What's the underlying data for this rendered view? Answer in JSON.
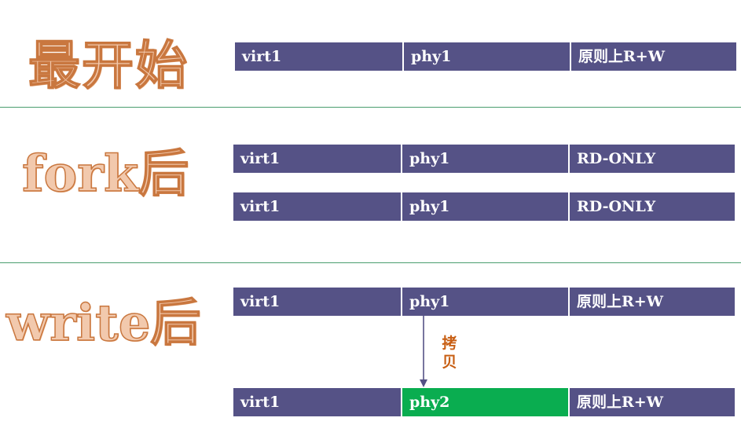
{
  "sections": {
    "start": {
      "title": "最开始"
    },
    "fork": {
      "title": "fork后"
    },
    "write": {
      "title": "write后"
    }
  },
  "rows": {
    "start": {
      "virt": "virt1",
      "phys": "phy1",
      "perm": "原则上R+W"
    },
    "fork_1": {
      "virt": "virt1",
      "phys": "phy1",
      "perm": "RD-ONLY"
    },
    "fork_2": {
      "virt": "virt1",
      "phys": "phy1",
      "perm": "RD-ONLY"
    },
    "write_1": {
      "virt": "virt1",
      "phys": "phy1",
      "perm": "原则上R+W"
    },
    "write_2": {
      "virt": "virt1",
      "phys": "phy2",
      "perm": "原则上R+W"
    }
  },
  "copy_label": "拷贝",
  "colors": {
    "cell": "#555286",
    "new_page": "#0aad50",
    "title_fill": "#f2c9ad",
    "title_stroke": "#c9773f",
    "copy_label": "#c85f14",
    "divider": "#4a9d6e"
  }
}
